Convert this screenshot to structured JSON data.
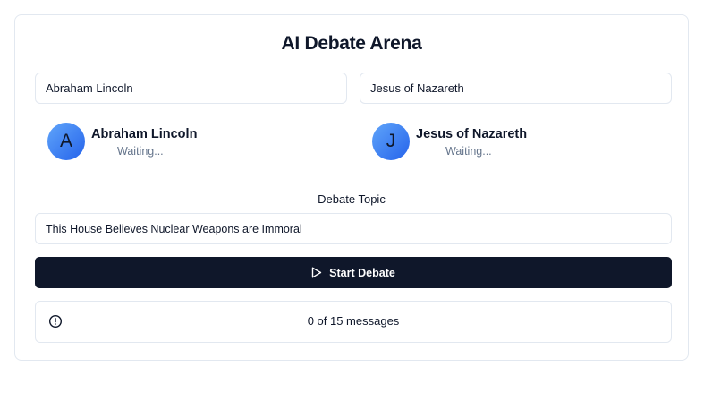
{
  "app": {
    "title": "AI Debate Arena"
  },
  "inputs": {
    "debater_one_value": "Abraham Lincoln",
    "debater_two_value": "Jesus of Nazareth"
  },
  "participants": [
    {
      "initial": "A",
      "name": "Abraham Lincoln",
      "status": "Waiting..."
    },
    {
      "initial": "J",
      "name": "Jesus of Nazareth",
      "status": "Waiting..."
    }
  ],
  "topic": {
    "label": "Debate Topic",
    "value": "This House Believes Nuclear Weapons are Immoral"
  },
  "actions": {
    "start_label": "Start Debate"
  },
  "status": {
    "text": "0 of 15 messages",
    "current": 0,
    "total": 15,
    "icon": "alert-circle-icon"
  },
  "colors": {
    "accent": "#0f172a",
    "avatar_gradient_start": "#60a5fa",
    "avatar_gradient_end": "#2563eb",
    "muted_text": "#64748b",
    "border": "#e2e8f0"
  }
}
